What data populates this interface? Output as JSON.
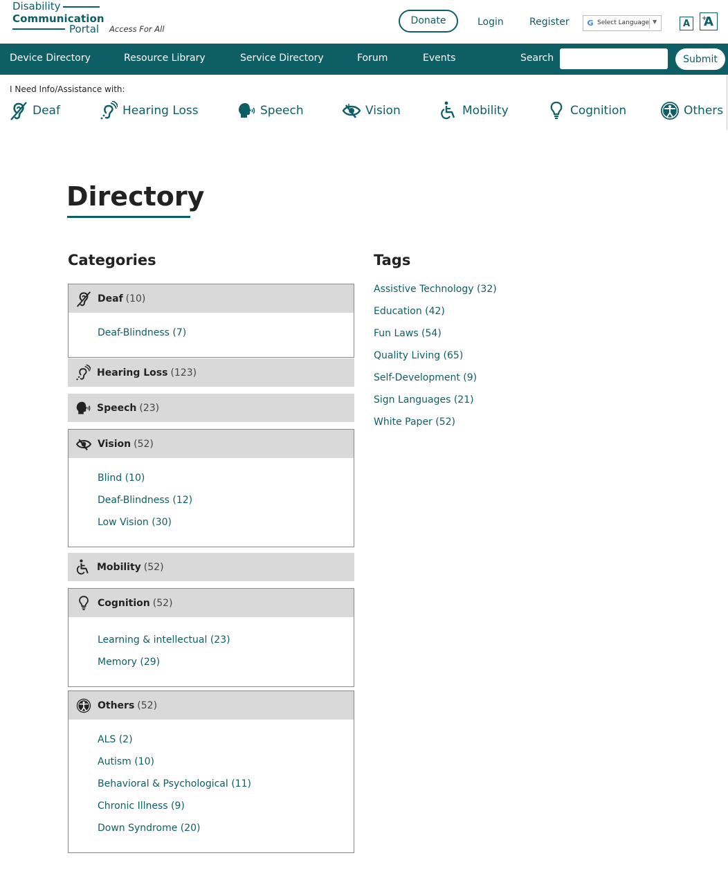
{
  "logo": {
    "line1": "Disability",
    "line2": "Communication",
    "line3": "Portal",
    "tagline": "Access For All"
  },
  "header": {
    "donate": "Donate",
    "login": "Login",
    "register": "Register",
    "language": "Select Language",
    "google_mark": "G",
    "font_small": "A",
    "font_large": "A",
    "font_plus": "+"
  },
  "nav": {
    "items": [
      "Device Directory",
      "Resource Library",
      "Service Directory",
      "Forum",
      "Events"
    ],
    "search_label": "Search",
    "submit": "Submit",
    "search_value": ""
  },
  "assist": {
    "label": "I Need Info/Assistance with:",
    "items": [
      {
        "label": "Deaf",
        "icon": "deaf-ear-icon"
      },
      {
        "label": "Hearing Loss",
        "icon": "hearing-loss-icon"
      },
      {
        "label": "Speech",
        "icon": "speech-head-icon"
      },
      {
        "label": "Vision",
        "icon": "vision-eye-icon"
      },
      {
        "label": "Mobility",
        "icon": "wheelchair-icon"
      },
      {
        "label": "Cognition",
        "icon": "lightbulb-icon"
      },
      {
        "label": "Others",
        "icon": "accessibility-icon"
      }
    ]
  },
  "main": {
    "title": "Directory",
    "categories_heading": "Categories",
    "tags_heading": "Tags",
    "categories": [
      {
        "name": "Deaf",
        "count": "(10)",
        "icon": "deaf-ear-icon",
        "subs": [
          "Deaf-Blindness (7)"
        ]
      },
      {
        "name": "Hearing Loss",
        "count": "(123)",
        "icon": "hearing-loss-icon",
        "subs": []
      },
      {
        "name": "Speech",
        "count": "(23)",
        "icon": "speech-head-icon",
        "subs": []
      },
      {
        "name": "Vision",
        "count": "(52)",
        "icon": "vision-eye-icon",
        "subs": [
          "Blind (10)",
          "Deaf-Blindness (12)",
          "Low Vision (30)"
        ]
      },
      {
        "name": "Mobility",
        "count": "(52)",
        "icon": "wheelchair-icon",
        "subs": []
      },
      {
        "name": "Cognition",
        "count": "(52)",
        "icon": "lightbulb-icon",
        "subs": [
          "Learning & intellectual (23)",
          "Memory (29)"
        ]
      },
      {
        "name": "Others",
        "count": "(52)",
        "icon": "accessibility-icon",
        "subs": [
          "ALS (2)",
          "Autism (10)",
          "Behavioral & Psychological (11)",
          "Chronic Illness (9)",
          "Down Syndrome (20)"
        ]
      }
    ],
    "tags": [
      "Assistive Technology (32)",
      "Education (42)",
      "Fun Laws (54)",
      "Quality Living (65)",
      "Self-Development (9)",
      "Sign Languages (21)",
      "White Paper (52)"
    ]
  },
  "colors": {
    "brand": "#0d5e65",
    "category_header": "#d9d9d9"
  }
}
